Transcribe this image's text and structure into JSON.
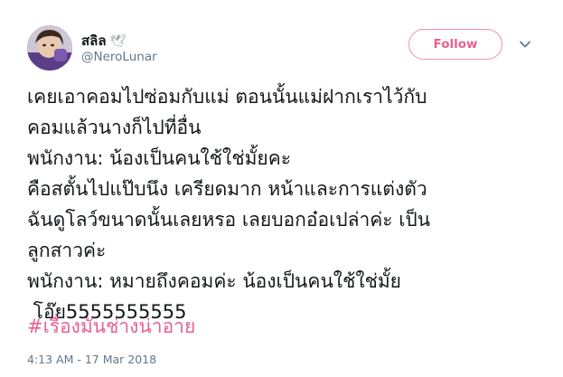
{
  "tweet": {
    "display_name": "สลิล",
    "display_name_emoji": "🕊",
    "username": "@NeroLunar",
    "follow_label": "Follow",
    "text_lines": [
      "เคยเอาคอมไปซ่อมกับแม่ ตอนนั้นแม่ฝากเราไว้กับ",
      "คอมแล้วนางก็ไปที่อื่น",
      "พนักงาน: น้องเป็นคนใช้ใช่มั้ยคะ",
      "คือสตั้นไปแป๊บนึง เครียดมาก หน้าและการแต่งตัว",
      "ฉันดูโลว์ขนาดนั้นเลยหรอ เลยบอกอ๋อเปล่าค่ะ เป็น",
      "ลูกสาวค่ะ",
      "พนักงาน: หมายถึงคอมค่ะ น้องเป็นคนใช้ใช่มั้ย",
      " โอ๊ย5555555555"
    ],
    "hashtag": "#เรื่องมันช่างน่าอาย",
    "timestamp": "4:13 AM - 17 Mar 2018"
  },
  "colors": {
    "accent": "#e9608f",
    "follow_border": "#f18fb4",
    "text_primary": "#14171a",
    "text_secondary": "#657786"
  }
}
